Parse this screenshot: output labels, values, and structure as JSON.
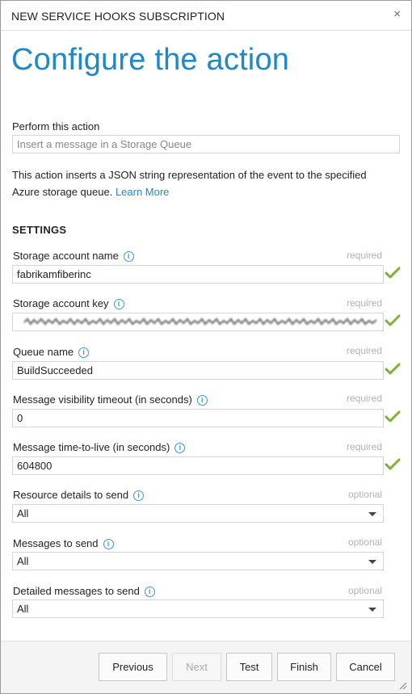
{
  "dialog": {
    "title": "NEW SERVICE HOOKS SUBSCRIPTION",
    "close_glyph": "×",
    "heading": "Configure the action"
  },
  "action": {
    "label": "Perform this action",
    "placeholder": "Insert a message in a Storage Queue",
    "description": "This action inserts a JSON string representation of the event to the specified Azure storage queue.",
    "learn_more": "Learn More"
  },
  "settings": {
    "heading": "SETTINGS",
    "storage_account_name": {
      "label": "Storage account name",
      "hint": "required",
      "value": "fabrikamfiberinc"
    },
    "storage_account_key": {
      "label": "Storage account key",
      "hint": "required",
      "value": ""
    },
    "queue_name": {
      "label": "Queue name",
      "hint": "required",
      "value": "BuildSucceeded"
    },
    "visibility_timeout": {
      "label": "Message visibility timeout (in seconds)",
      "hint": "required",
      "value": "0"
    },
    "time_to_live": {
      "label": "Message time-to-live (in seconds)",
      "hint": "required",
      "value": "604800"
    },
    "resource_details": {
      "label": "Resource details to send",
      "hint": "optional",
      "value": "All"
    },
    "messages": {
      "label": "Messages to send",
      "hint": "optional",
      "value": "All"
    },
    "detailed_messages": {
      "label": "Detailed messages to send",
      "hint": "optional",
      "value": "All"
    }
  },
  "footer": {
    "previous": "Previous",
    "next": "Next",
    "test": "Test",
    "finish": "Finish",
    "cancel": "Cancel"
  },
  "icons": {
    "info": "info-icon",
    "check": "checkmark-icon",
    "dropdown": "chevron-down-icon",
    "close": "close-icon",
    "resize": "resize-grip-icon"
  },
  "colors": {
    "accent": "#1e88c8",
    "valid": "#7ab23a",
    "info": "#3a9ad9",
    "hint": "#b3b3b3"
  }
}
